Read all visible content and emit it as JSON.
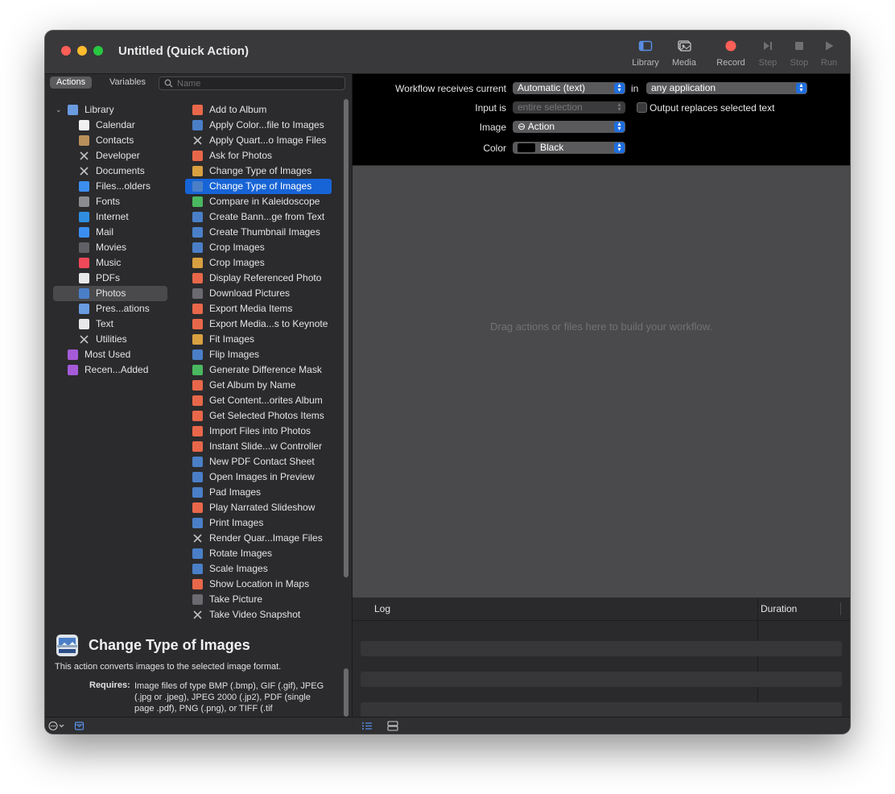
{
  "window": {
    "title": "Untitled (Quick Action)"
  },
  "toolbar": {
    "library": "Library",
    "media": "Media",
    "record": "Record",
    "step": "Step",
    "stop": "Stop",
    "run": "Run"
  },
  "sidebar": {
    "tab_actions": "Actions",
    "tab_variables": "Variables",
    "search_placeholder": "Name"
  },
  "library": [
    {
      "label": "Library",
      "icon": "books-icon"
    },
    {
      "label": "Calendar",
      "icon": "calendar-icon"
    },
    {
      "label": "Contacts",
      "icon": "contacts-icon"
    },
    {
      "label": "Developer",
      "icon": "tools-icon"
    },
    {
      "label": "Documents",
      "icon": "tools-icon"
    },
    {
      "label": "Files...olders",
      "icon": "finder-icon"
    },
    {
      "label": "Fonts",
      "icon": "fonts-icon"
    },
    {
      "label": "Internet",
      "icon": "globe-icon"
    },
    {
      "label": "Mail",
      "icon": "mail-icon"
    },
    {
      "label": "Movies",
      "icon": "movies-icon"
    },
    {
      "label": "Music",
      "icon": "music-icon"
    },
    {
      "label": "PDFs",
      "icon": "pdf-icon"
    },
    {
      "label": "Photos",
      "icon": "photos-icon"
    },
    {
      "label": "Pres...ations",
      "icon": "presentation-icon"
    },
    {
      "label": "Text",
      "icon": "text-icon"
    },
    {
      "label": "Utilities",
      "icon": "tools-icon"
    },
    {
      "label": "Most Used",
      "icon": "folder-icon"
    },
    {
      "label": "Recen...Added",
      "icon": "folder-icon"
    }
  ],
  "actions": [
    "Add to Album",
    "Apply Color...file to Images",
    "Apply Quart...o Image Files",
    "Ask for Photos",
    "Change Type of Images",
    "Change Type of Images",
    "Compare in Kaleidoscope",
    "Create Bann...ge from Text",
    "Create Thumbnail Images",
    "Crop Images",
    "Crop Images",
    "Display Referenced Photo",
    "Download Pictures",
    "Export Media Items",
    "Export Media...s to Keynote",
    "Fit Images",
    "Flip Images",
    "Generate Difference Mask",
    "Get Album by Name",
    "Get Content...orites Album",
    "Get Selected Photos Items",
    "Import Files into Photos",
    "Instant Slide...w Controller",
    "New PDF Contact Sheet",
    "Open Images in Preview",
    "Pad Images",
    "Play Narrated Slideshow",
    "Print Images",
    "Render Quar...Image Files",
    "Rotate Images",
    "Scale Images",
    "Show Location in Maps",
    "Take Picture",
    "Take Video Snapshot"
  ],
  "description": {
    "title": "Change Type of Images",
    "text": "This action converts images to the selected image format.",
    "requires_label": "Requires:",
    "requires_text": "Image files of type BMP (.bmp), GIF (.gif), JPEG (.jpg or .jpeg), JPEG 2000 (.jp2), PDF (single page .pdf), PNG (.png), or TIFF (.tif"
  },
  "workflow": {
    "receives_label": "Workflow receives current",
    "receives_value": "Automatic (text)",
    "in_label": "in",
    "app_value": "any application",
    "input_label": "Input is",
    "input_value": "entire selection",
    "output_replaces": "Output replaces selected text",
    "image_label": "Image",
    "image_value": "⊖ Action",
    "color_label": "Color",
    "color_value": "Black",
    "hint": "Drag actions or files here to build your workflow."
  },
  "log": {
    "col_log": "Log",
    "col_duration": "Duration"
  },
  "colors": {
    "selection": "#1764d6",
    "record": "#ff5f57"
  }
}
